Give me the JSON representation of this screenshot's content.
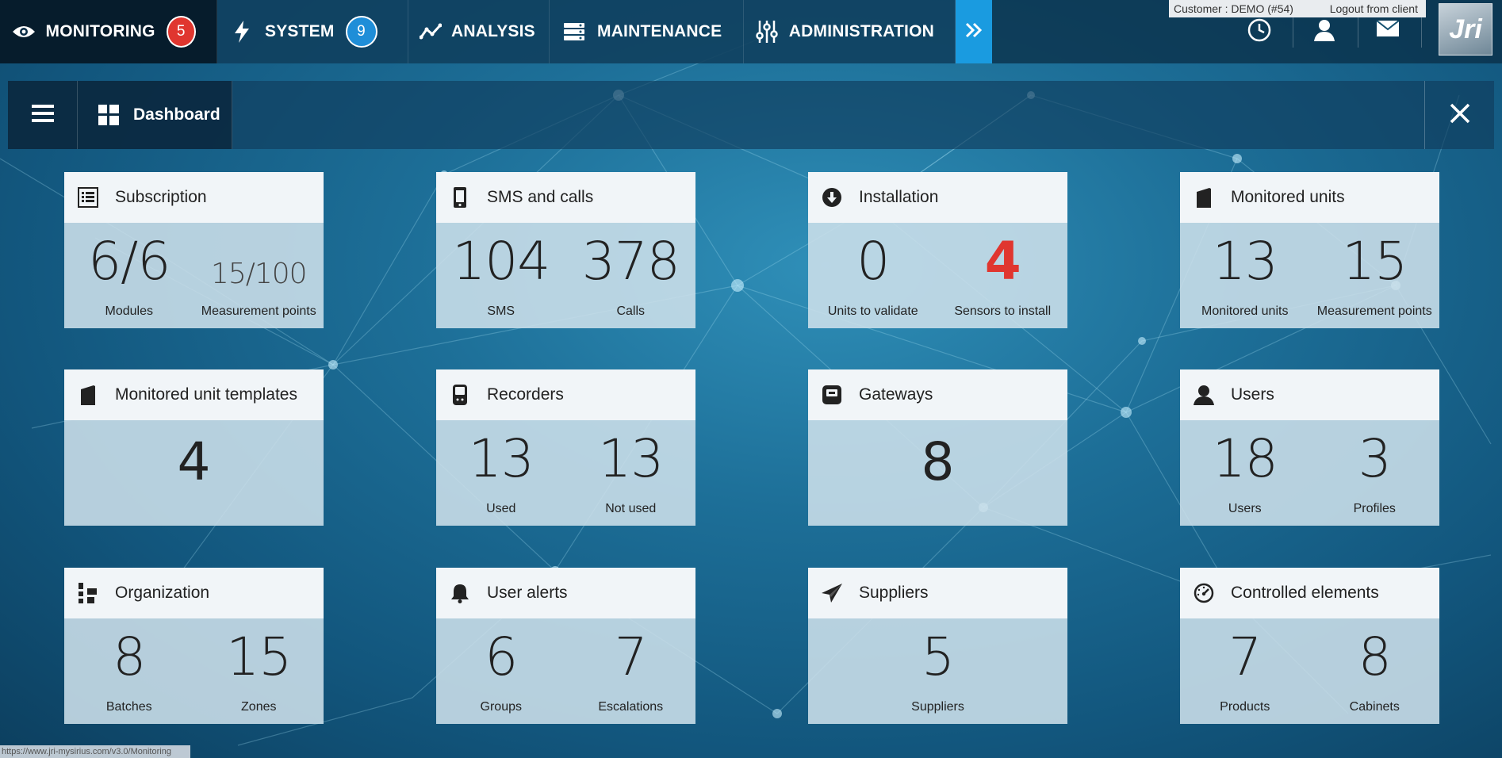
{
  "nav": {
    "items": [
      {
        "label": "MONITORING",
        "badge": "5",
        "icon": "eye-icon"
      },
      {
        "label": "SYSTEM",
        "badge": "9",
        "icon": "lightning-icon"
      },
      {
        "label": "ANALYSIS",
        "icon": "chart-line-icon"
      },
      {
        "label": "MAINTENANCE",
        "icon": "server-icon"
      },
      {
        "label": "ADMINISTRATION",
        "icon": "sliders-icon"
      }
    ],
    "more_icon": "double-chevron-right-icon"
  },
  "header_right": {
    "customer": "Customer : DEMO (#54)",
    "logout": "Logout from client",
    "logo_text": "Jri"
  },
  "panel": {
    "tab_label": "Dashboard"
  },
  "cards": [
    {
      "title": "Subscription",
      "icon": "list-icon",
      "stats": [
        {
          "value": "6/6",
          "label": "Modules"
        },
        {
          "value": "15/100",
          "label": "Measurement points"
        }
      ]
    },
    {
      "title": "SMS and calls",
      "icon": "phone-icon",
      "stats": [
        {
          "value": "104",
          "label": "SMS"
        },
        {
          "value": "378",
          "label": "Calls"
        }
      ]
    },
    {
      "title": "Installation",
      "icon": "download-icon",
      "stats": [
        {
          "value": "0",
          "label": "Units to validate"
        },
        {
          "value": "4",
          "label": "Sensors to install"
        }
      ]
    },
    {
      "title": "Monitored units",
      "icon": "fridge-icon",
      "stats": [
        {
          "value": "13",
          "label": "Monitored units"
        },
        {
          "value": "15",
          "label": "Measurement points"
        }
      ]
    },
    {
      "title": "Monitored unit templates",
      "icon": "fridge-icon",
      "single": "4"
    },
    {
      "title": "Recorders",
      "icon": "recorder-icon",
      "stats": [
        {
          "value": "13",
          "label": "Used"
        },
        {
          "value": "13",
          "label": "Not used"
        }
      ]
    },
    {
      "title": "Gateways",
      "icon": "gateway-icon",
      "single": "8"
    },
    {
      "title": "Users",
      "icon": "user-icon",
      "stats": [
        {
          "value": "18",
          "label": "Users"
        },
        {
          "value": "3",
          "label": "Profiles"
        }
      ]
    },
    {
      "title": "Organization",
      "icon": "organization-icon",
      "stats": [
        {
          "value": "8",
          "label": "Batches"
        },
        {
          "value": "15",
          "label": "Zones"
        }
      ]
    },
    {
      "title": "User alerts",
      "icon": "bell-icon",
      "stats": [
        {
          "value": "6",
          "label": "Groups"
        },
        {
          "value": "7",
          "label": "Escalations"
        }
      ]
    },
    {
      "title": "Suppliers",
      "icon": "paper-plane-icon",
      "single": "5",
      "single_label": "Suppliers"
    },
    {
      "title": "Controlled elements",
      "icon": "gauge-icon",
      "stats": [
        {
          "value": "7",
          "label": "Products"
        },
        {
          "value": "8",
          "label": "Cabinets"
        }
      ]
    }
  ],
  "status_url": "https://www.jri-mysirius.com/v3.0/Monitoring",
  "colors": {
    "alert_red": "#e0362f",
    "badge_blue": "#1f8ed8",
    "more_blue": "#1a9be0"
  }
}
